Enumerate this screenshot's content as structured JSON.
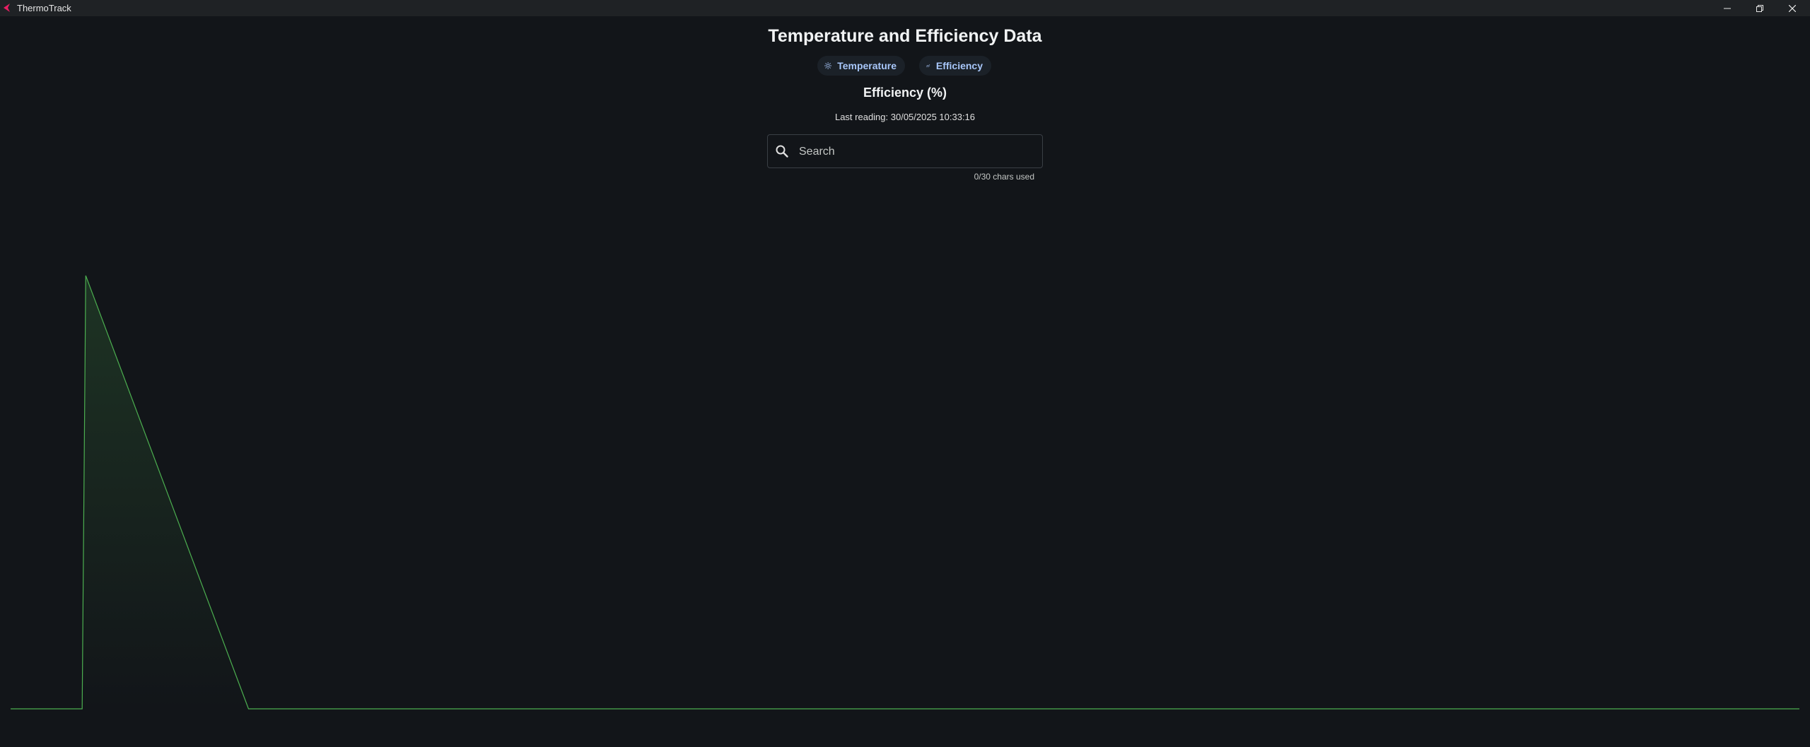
{
  "window": {
    "title": "ThermoTrack",
    "logo_icon": "thermotrack-logo-icon",
    "controls": [
      "minimize-icon",
      "restore-icon",
      "close-icon"
    ]
  },
  "page": {
    "title": "Temperature and Efficiency Data"
  },
  "tabs": [
    {
      "label": "Temperature",
      "icon": "sun-icon",
      "selected": false
    },
    {
      "label": "Efficiency",
      "icon": "chart-line-icon",
      "selected": true
    }
  ],
  "section": {
    "title": "Efficiency (%)",
    "last_reading": "Last reading: 30/05/2025 10:33:16"
  },
  "search": {
    "value": "",
    "placeholder": "Search",
    "counter": "0/30 chars used"
  },
  "colors": {
    "background": "#121519",
    "accent": "#a8c7fa",
    "series_line": "#4caf50",
    "logo": "#e91e63"
  },
  "chart_data": {
    "type": "area",
    "title": "",
    "xlabel": "",
    "ylabel": "",
    "grid": false,
    "legend": "none",
    "ylim": [
      0,
      100
    ],
    "series": [
      {
        "values": [
          0,
          0,
          100,
          0,
          0
        ]
      }
    ],
    "x": [
      0,
      0.04,
      0.042,
      0.133,
      1
    ]
  }
}
